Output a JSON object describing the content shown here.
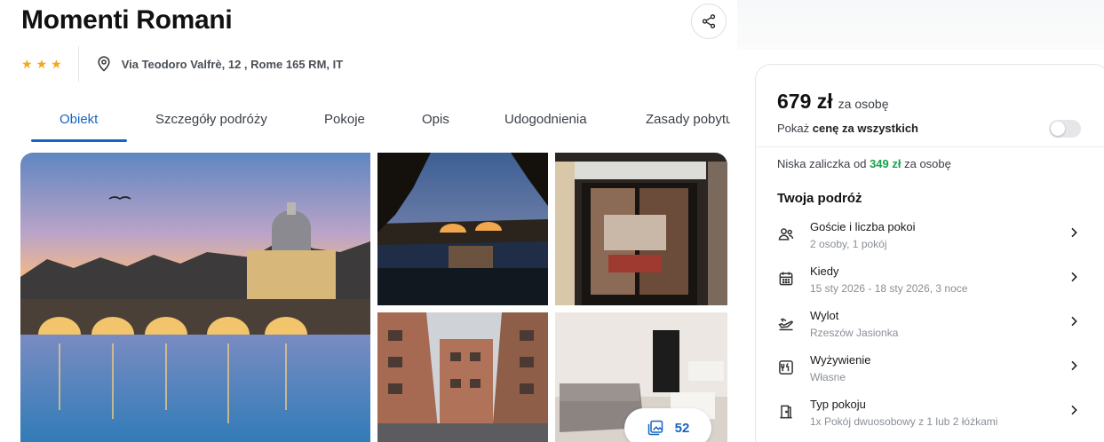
{
  "hotel": {
    "name": "Momenti Romani",
    "stars": [
      "★",
      "★",
      "★"
    ],
    "address": "Via Teodoro Valfrè, 12 , Rome 165 RM, IT"
  },
  "tabs": [
    {
      "label": "Obiekt"
    },
    {
      "label": "Szczegóły podróży"
    },
    {
      "label": "Pokoje"
    },
    {
      "label": "Opis"
    },
    {
      "label": "Udogodnienia"
    },
    {
      "label": "Zasady pobytu"
    }
  ],
  "gallery": {
    "photo_count": "52"
  },
  "booking": {
    "price": "679 zł",
    "price_unit": "za osobę",
    "total_prefix": "Pokaż",
    "total_bold": "cenę za wszystkich",
    "total_toggle_on": false,
    "deposit_prefix": "Niska zaliczka od",
    "deposit_amount": "349 zł",
    "deposit_suffix": "za osobę",
    "trip_heading": "Twoja podróż",
    "trip_items": [
      {
        "icon": "guests-icon",
        "label": "Goście i liczba pokoi",
        "value": "2 osoby, 1 pokój"
      },
      {
        "icon": "calendar-icon",
        "label": "Kiedy",
        "value": "15 sty 2026 - 18 sty 2026, 3 noce"
      },
      {
        "icon": "plane-departure-icon",
        "label": "Wylot",
        "value": "Rzeszów Jasionka"
      },
      {
        "icon": "meal-icon",
        "label": "Wyżywienie",
        "value": "Własne"
      },
      {
        "icon": "room-door-icon",
        "label": "Typ pokoju",
        "value": "1x Pokój dwuosobowy z 1 lub 2 łóżkami"
      }
    ]
  },
  "colors": {
    "accent": "#1565c0",
    "star": "#f4a71d",
    "deposit": "#16a34a"
  }
}
